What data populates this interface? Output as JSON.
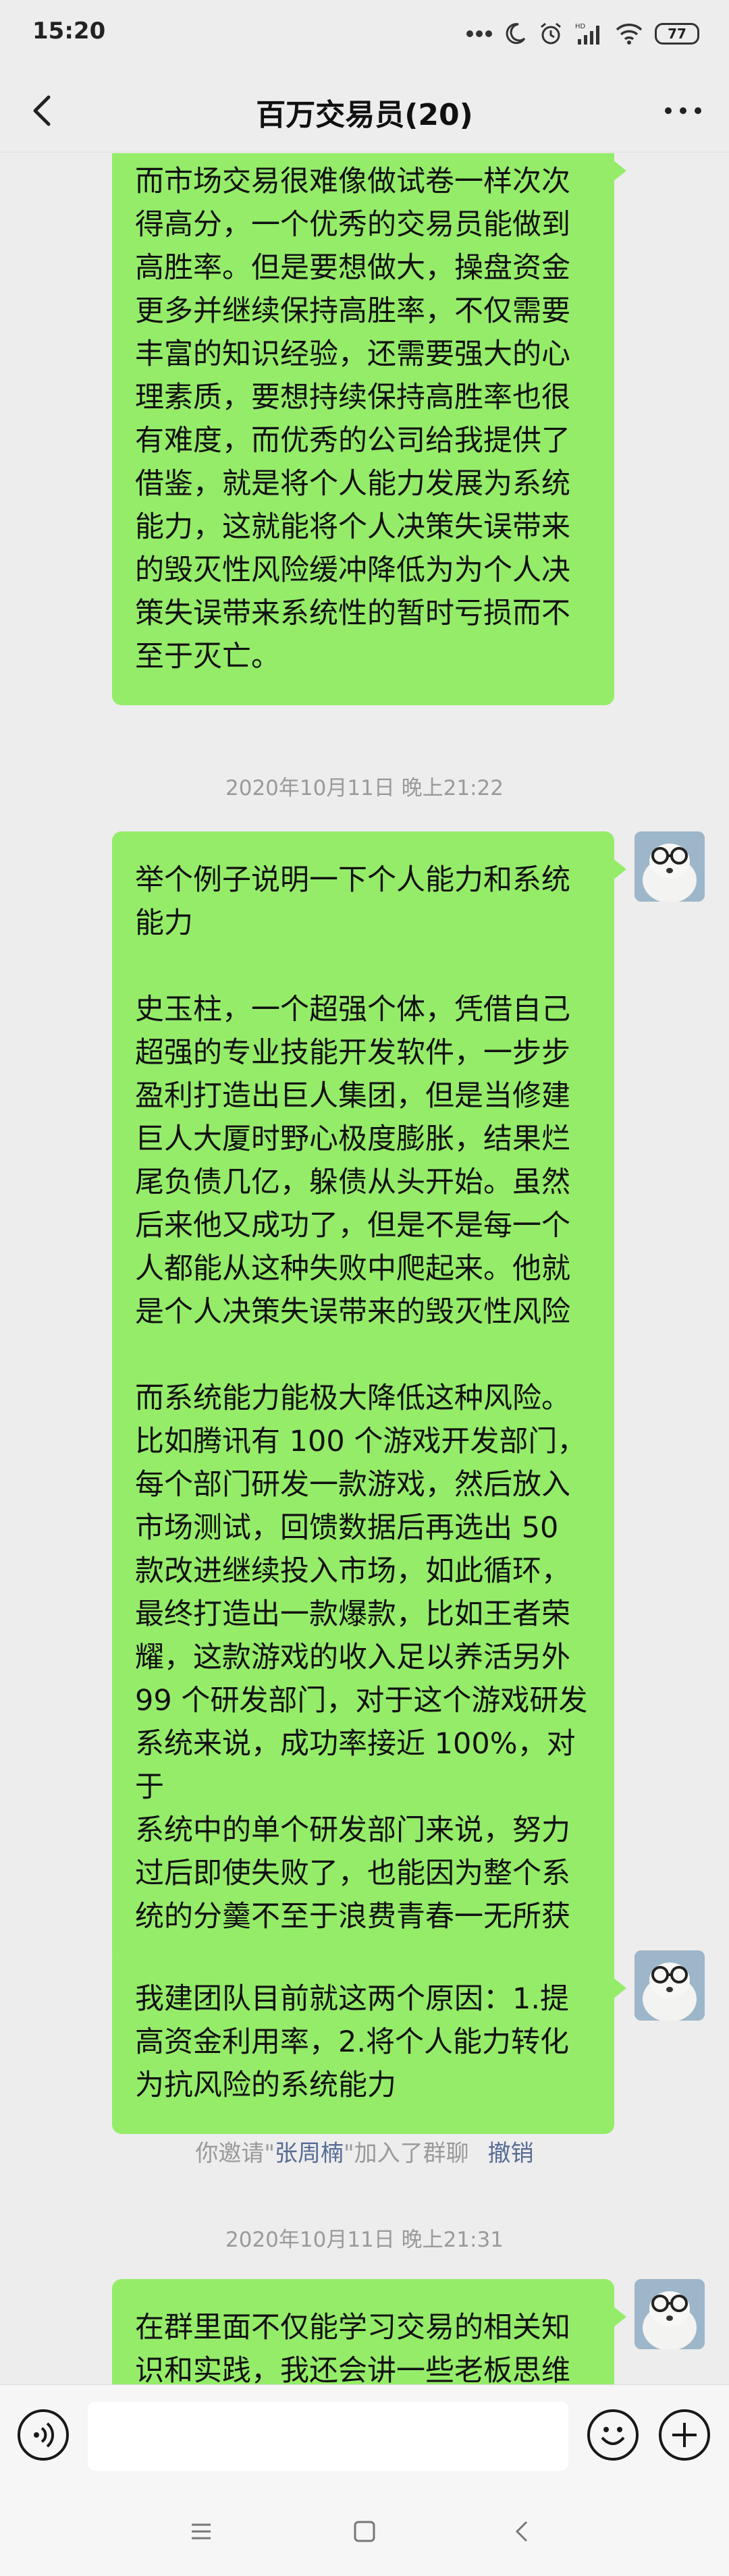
{
  "status": {
    "time": "15:20",
    "battery": "77",
    "icons": [
      "more-dots-icon",
      "moon-icon",
      "alarm-icon",
      "hd-signal-icon",
      "wifi-icon",
      "battery-icon"
    ]
  },
  "header": {
    "title": "百万交易员(20)",
    "back_icon": "chevron-left-icon",
    "more_icon": "more-icon"
  },
  "messages": {
    "m1": "而市场交易很难像做试卷一样次次\n得高分，一个优秀的交易员能做到\n高胜率。但是要想做大，操盘资金\n更多并继续保持高胜率，不仅需要\n丰富的知识经验，还需要强大的心\n理素质，要想持续保持高胜率也很\n有难度，而优秀的公司给我提供了\n借鉴，就是将个人能力发展为系统\n能力，这就能将个人决策失误带来\n的毁灭性风险缓冲降低为为个人决\n策失误带来系统性的暂时亏损而不\n至于灭亡。",
    "t1": "2020年10月11日 晚上21:22",
    "m2": "举个例子说明一下个人能力和系统\n能力\n\n史玉柱，一个超强个体，凭借自己\n超强的专业技能开发软件，一步步\n盈利打造出巨人集团，但是当修建\n巨人大厦时野心极度膨胀，结果烂\n尾负债几亿，躲债从头开始。虽然\n后来他又成功了，但是不是每一个\n人都能从这种失败中爬起来。他就\n是个人决策失误带来的毁灭性风险\n\n而系统能力能极大降低这种风险。\n比如腾讯有 100 个游戏开发部门，\n每个部门研发一款游戏，然后放入\n市场测试，回馈数据后再选出 50\n款改进继续投入市场，如此循环，\n最终打造出一款爆款，比如王者荣\n耀，这款游戏的收入足以养活另外\n99 个研发部门，对于这个游戏研发\n系统来说，成功率接近 100%，对于\n系统中的单个研发部门来说，努力\n过后即使失败了，也能因为整个系\n统的分羹不至于浪费青春一无所获",
    "m3": "我建团队目前就这两个原因：1.提\n高资金利用率，2.将个人能力转化\n为抗风险的系统能力",
    "sys_prefix": "你邀请\"",
    "sys_name": "张周楠",
    "sys_suffix": "\"加入了群聊",
    "sys_undo": "撤销",
    "t2": "2020年10月11日 晚上21:31",
    "m4": "在群里面不仅能学习交易的相关知\n识和实践，我还会讲一些老板思维"
  },
  "input": {
    "voice_icon": "voice-icon",
    "emoji_icon": "emoji-icon",
    "plus_icon": "plus-icon",
    "value": ""
  },
  "sysnav": {
    "icons": [
      "menu-icon",
      "home-icon",
      "back-icon"
    ]
  },
  "colors": {
    "bubble": "#95ec69",
    "background": "#ededed",
    "link": "#576b95",
    "timestamp": "#9a9a9a"
  }
}
